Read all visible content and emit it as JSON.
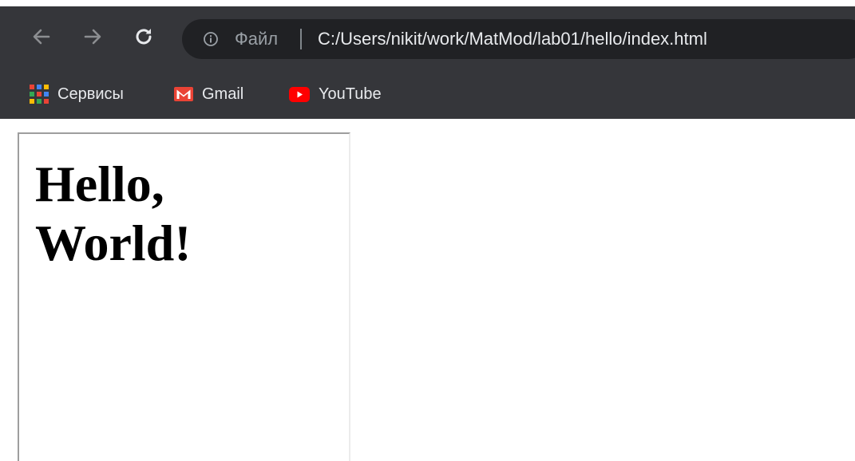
{
  "toolbar": {
    "url_scheme_label": "Файл",
    "url": "C:/Users/nikit/work/MatMod/lab01/hello/index.html",
    "icons": {
      "back": "arrow-left-icon",
      "forward": "arrow-right-icon",
      "reload": "reload-icon",
      "site_info": "info-icon"
    }
  },
  "bookmarks": [
    {
      "label": "Сервисы",
      "icon": "apps-grid-icon"
    },
    {
      "label": "Gmail",
      "icon": "gmail-icon"
    },
    {
      "label": "YouTube",
      "icon": "youtube-icon"
    }
  ],
  "page": {
    "heading_line1": "Hello,",
    "heading_line2": "World!"
  },
  "colors": {
    "toolbar_bg": "#35363a",
    "omnibox_bg": "#202124",
    "gmail_red": "#ea4335",
    "youtube_red": "#ff0000"
  }
}
